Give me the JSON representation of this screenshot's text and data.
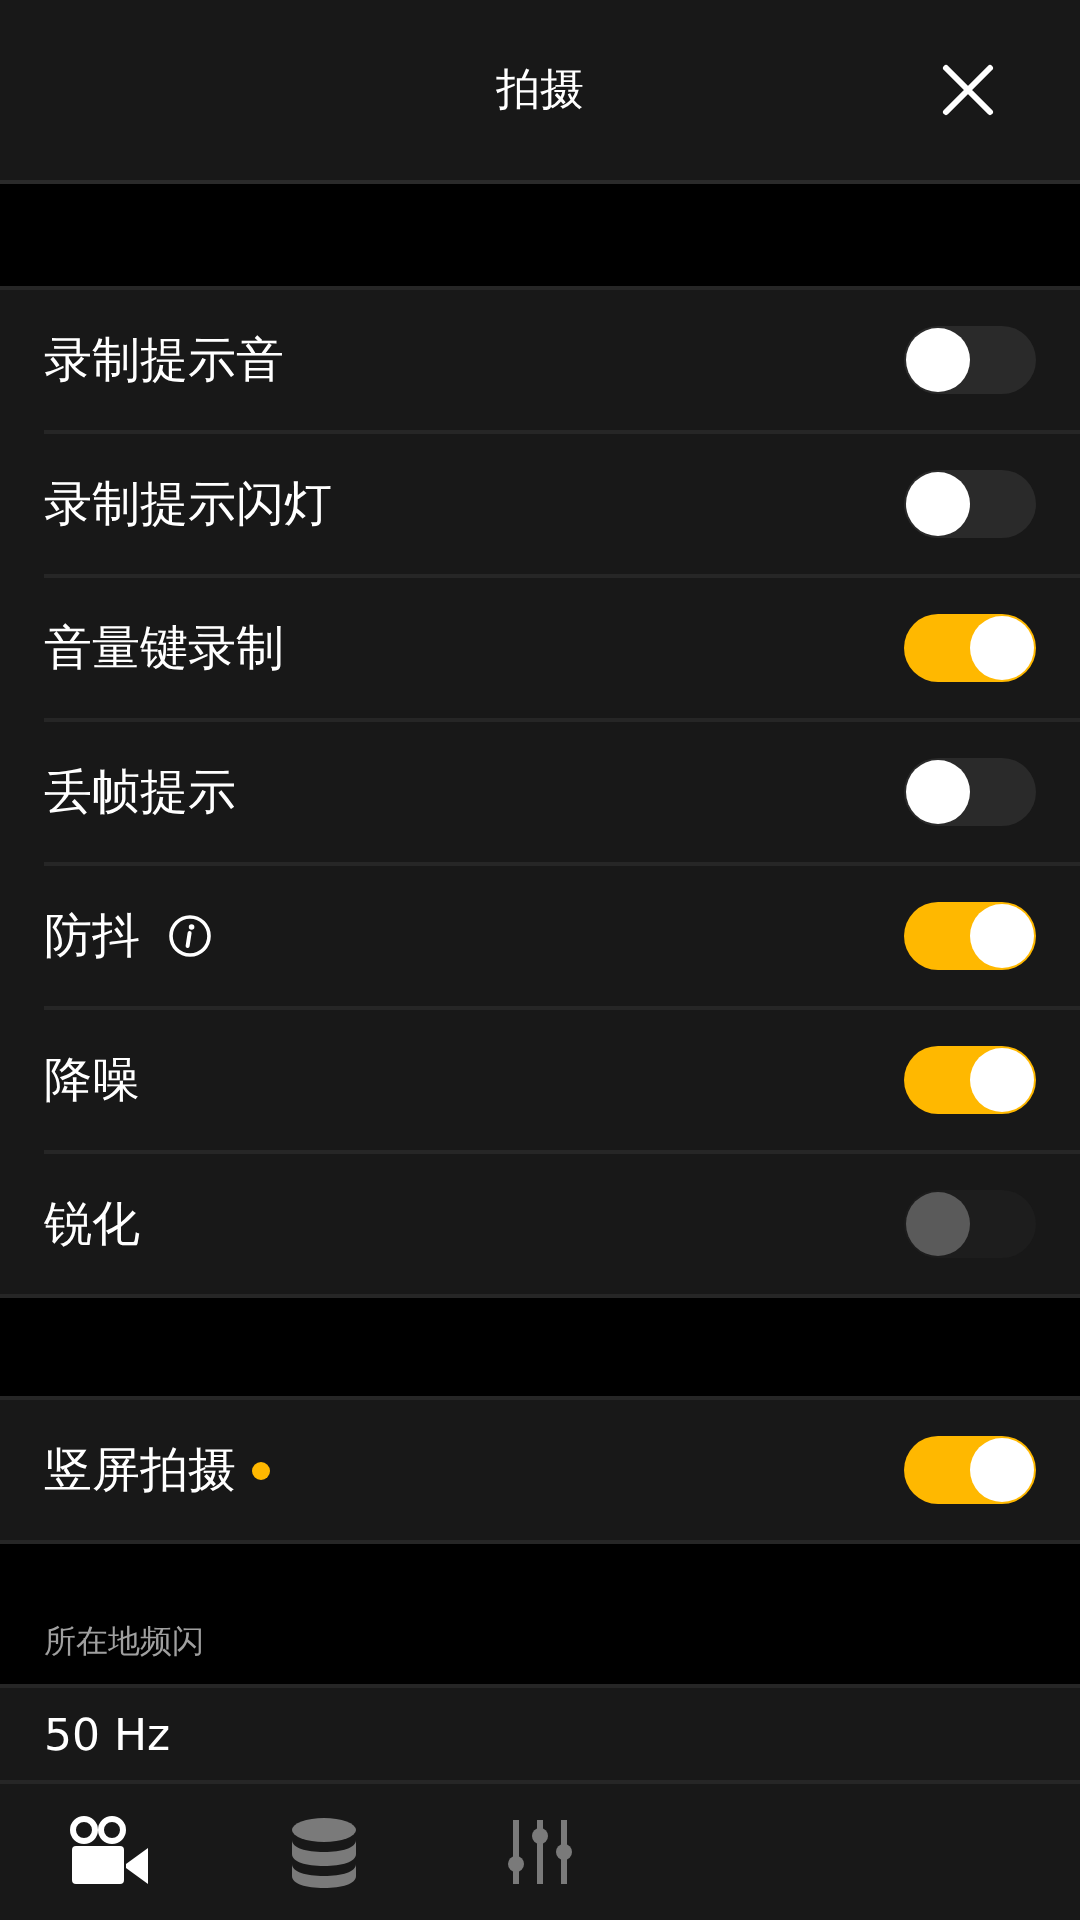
{
  "header": {
    "title": "拍摄"
  },
  "groups": [
    {
      "rows": [
        {
          "label": "录制提示音",
          "on": false,
          "disabled": false
        },
        {
          "label": "录制提示闪灯",
          "on": false,
          "disabled": false
        },
        {
          "label": "音量键录制",
          "on": true,
          "disabled": false
        },
        {
          "label": "丢帧提示",
          "on": false,
          "disabled": false
        },
        {
          "label": "防抖",
          "on": true,
          "disabled": false,
          "info": true
        },
        {
          "label": "降噪",
          "on": true,
          "disabled": false
        },
        {
          "label": "锐化",
          "on": false,
          "disabled": true
        }
      ]
    },
    {
      "rows": [
        {
          "label": "竖屏拍摄",
          "on": true,
          "disabled": false,
          "new_dot": true
        }
      ]
    }
  ],
  "section": {
    "label": "所在地频闪",
    "value": "50 Hz"
  },
  "tabs": [
    {
      "kind": "camera",
      "selected": true
    },
    {
      "kind": "storage",
      "selected": false
    },
    {
      "kind": "sliders",
      "selected": false
    }
  ]
}
